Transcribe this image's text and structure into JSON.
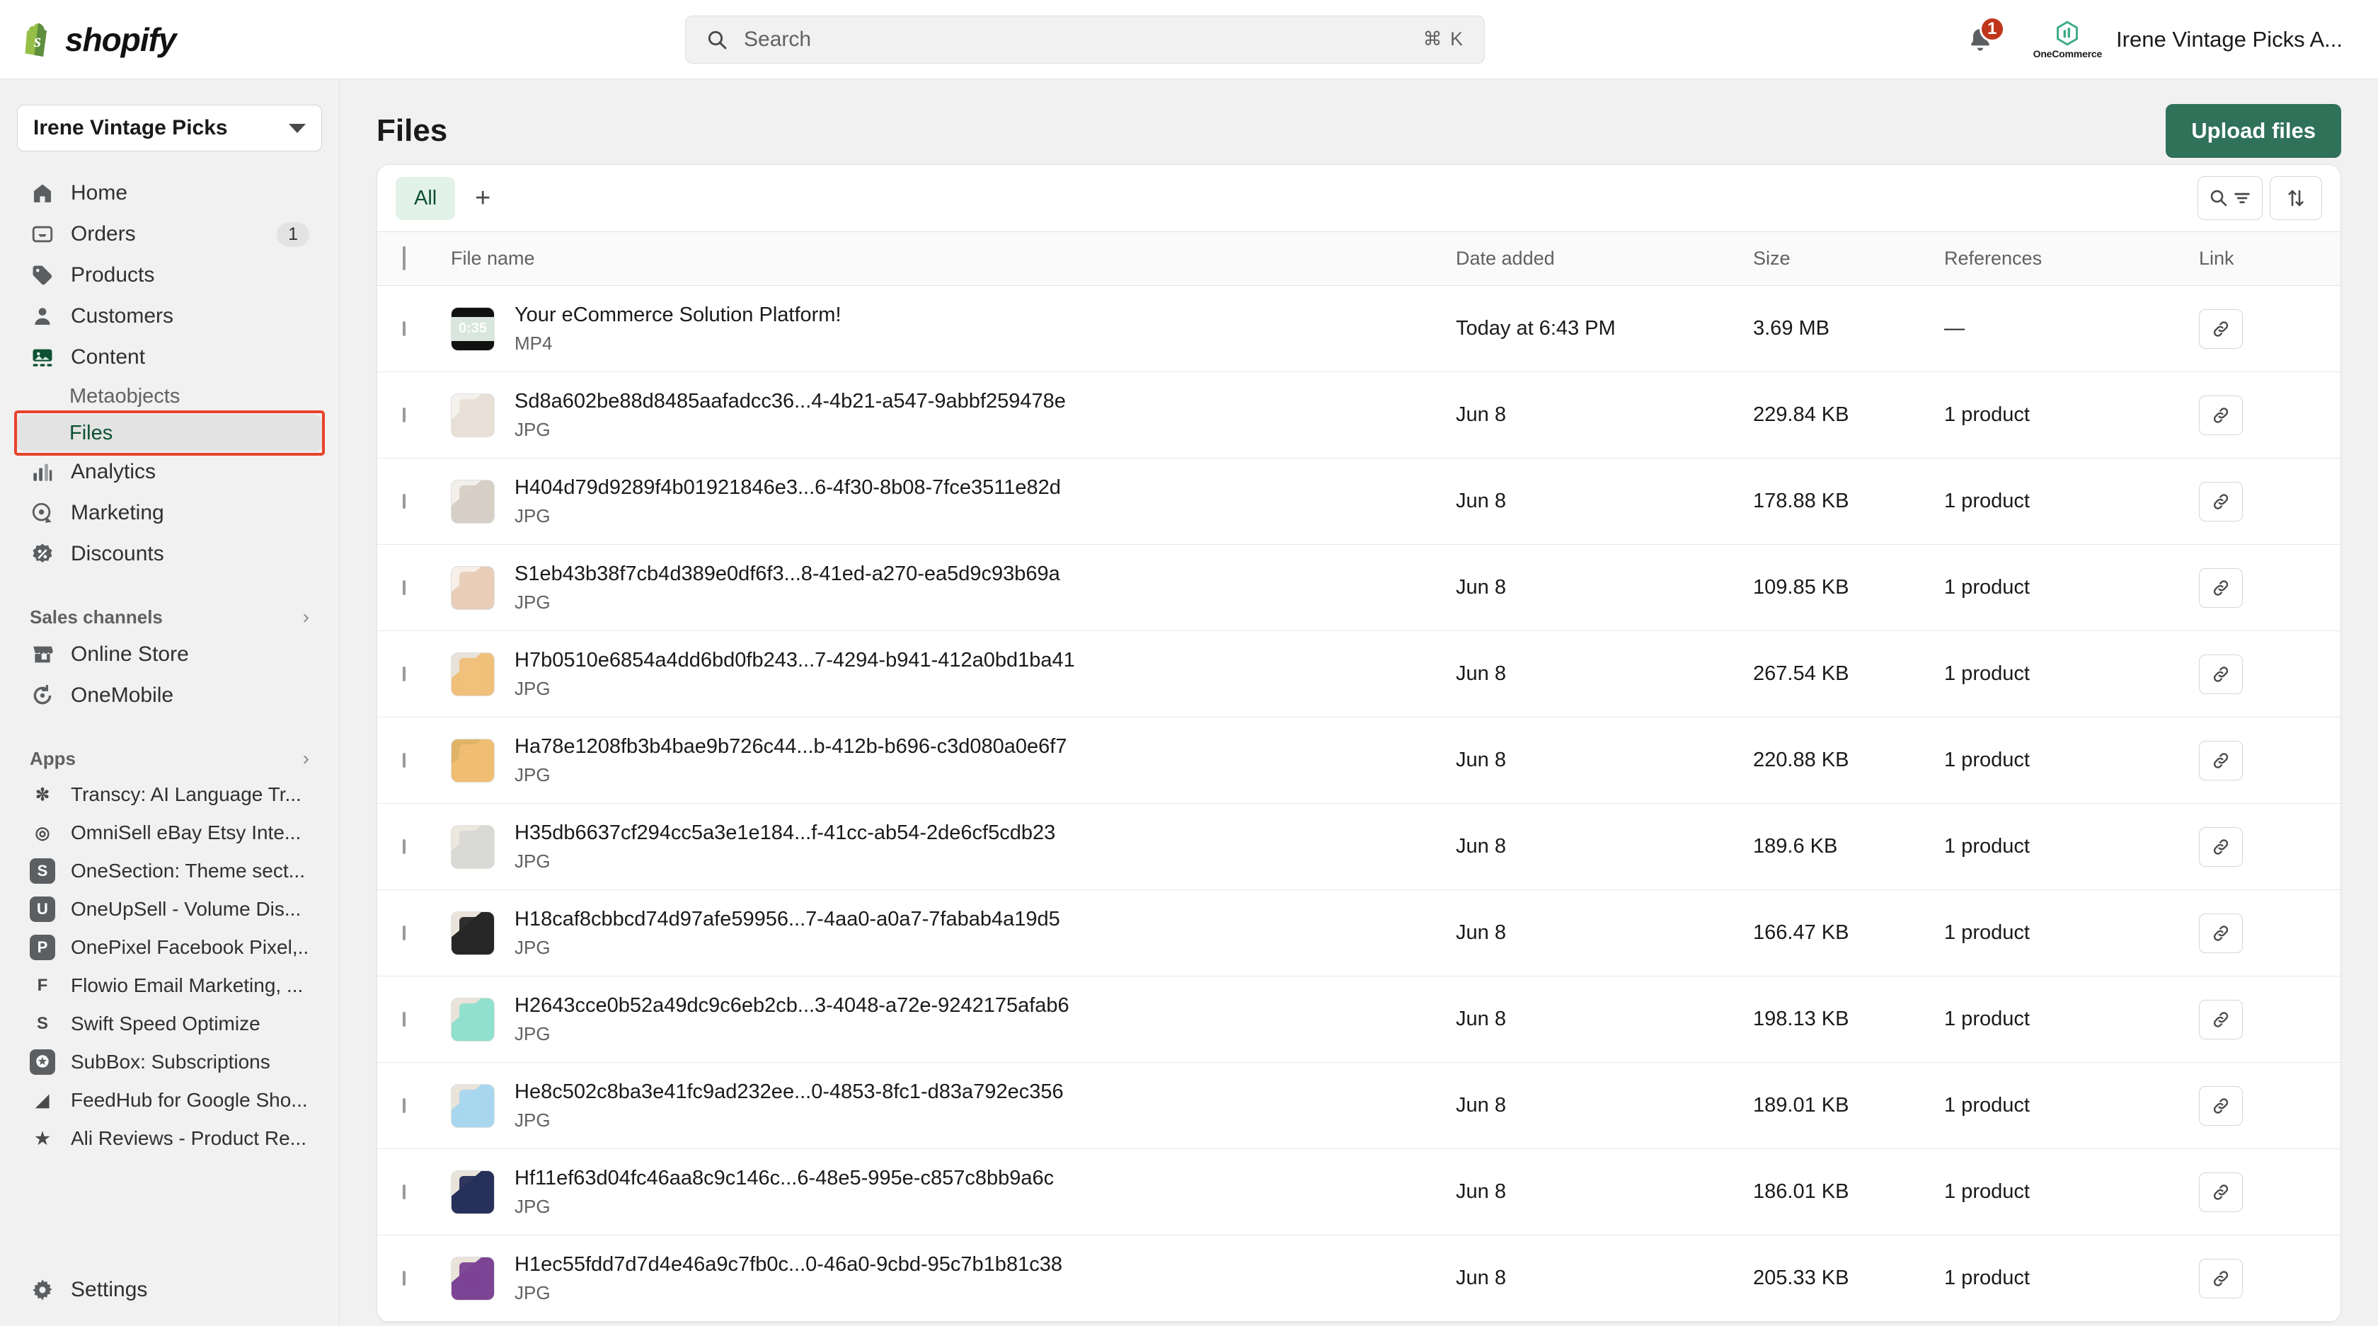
{
  "topbar": {
    "brand": "shopify",
    "search": {
      "placeholder": "Search",
      "shortcut": "⌘ K"
    },
    "notifications_count": "1",
    "account_app_name": "OneCommerce",
    "account_name": "Irene Vintage Picks A..."
  },
  "sidebar": {
    "store_name": "Irene Vintage Picks",
    "nav": [
      {
        "label": "Home",
        "icon": "home-icon",
        "badge": ""
      },
      {
        "label": "Orders",
        "icon": "orders-icon",
        "badge": "1"
      },
      {
        "label": "Products",
        "icon": "products-tag-icon",
        "badge": ""
      },
      {
        "label": "Customers",
        "icon": "customers-person-icon",
        "badge": ""
      },
      {
        "label": "Content",
        "icon": "content-image-icon",
        "badge": ""
      }
    ],
    "content_children": [
      {
        "label": "Metaobjects",
        "active": false
      },
      {
        "label": "Files",
        "active": true
      }
    ],
    "nav2": [
      {
        "label": "Analytics",
        "icon": "analytics-bars-icon"
      },
      {
        "label": "Marketing",
        "icon": "marketing-target-icon"
      },
      {
        "label": "Discounts",
        "icon": "discounts-percent-icon"
      }
    ],
    "sales_channels_title": "Sales channels",
    "sales_channels": [
      {
        "label": "Online Store",
        "icon": "online-store-icon"
      },
      {
        "label": "OneMobile",
        "icon": "onemobile-icon"
      }
    ],
    "apps_title": "Apps",
    "apps": [
      {
        "label": "Transcy: AI Language Tr...",
        "glyph": "✼",
        "boxed": false
      },
      {
        "label": "OmniSell eBay Etsy Inte...",
        "glyph": "◎",
        "boxed": false
      },
      {
        "label": "OneSection: Theme sect...",
        "glyph": "S",
        "boxed": true
      },
      {
        "label": "OneUpSell - Volume Dis...",
        "glyph": "U",
        "boxed": true
      },
      {
        "label": "OnePixel Facebook Pixel,...",
        "glyph": "P",
        "boxed": true
      },
      {
        "label": "Flowio Email Marketing, ...",
        "glyph": "F",
        "boxed": false
      },
      {
        "label": "Swift Speed Optimize",
        "glyph": "S",
        "boxed": false
      },
      {
        "label": "SubBox: Subscriptions",
        "glyph": "✪",
        "boxed": true
      },
      {
        "label": "FeedHub for Google Sho...",
        "glyph": "◢",
        "boxed": false
      },
      {
        "label": "Ali Reviews - Product Re...",
        "glyph": "★",
        "boxed": false
      }
    ],
    "settings_label": "Settings"
  },
  "main": {
    "page_title": "Files",
    "upload_button": "Upload files",
    "tabs": [
      {
        "label": "All",
        "active": true
      }
    ],
    "add_view_label": "+",
    "columns": [
      "File name",
      "Date added",
      "Size",
      "References",
      "Link"
    ],
    "rows": [
      {
        "name": "Your eCommerce Solution Platform!",
        "type": "MP4",
        "date": "Today at 6:43 PM",
        "size": "3.69 MB",
        "refs": "—",
        "thumb": "video",
        "duration": "0:35",
        "color1": "#d8e6dd",
        "color2": "#bcd3c3"
      },
      {
        "name": "Sd8a602be88d8485aafadcc36...4-4b21-a547-9abbf259478e",
        "type": "JPG",
        "date": "Jun 8",
        "size": "229.84 KB",
        "refs": "1 product",
        "thumb": "image",
        "duration": "",
        "color1": "#e8e0d6",
        "color2": "#f5f2ee"
      },
      {
        "name": "H404d79d9289f4b01921846e3...6-4f30-8b08-7fce3511e82d",
        "type": "JPG",
        "date": "Jun 8",
        "size": "178.88 KB",
        "refs": "1 product",
        "thumb": "image",
        "duration": "",
        "color1": "#d6cfc6",
        "color2": "#f3f0ec"
      },
      {
        "name": "S1eb43b38f7cb4d389e0df6f3...8-41ed-a270-ea5d9c93b69a",
        "type": "JPG",
        "date": "Jun 8",
        "size": "109.85 KB",
        "refs": "1 product",
        "thumb": "image",
        "duration": "",
        "color1": "#e9cdb8",
        "color2": "#f7efe8"
      },
      {
        "name": "H7b0510e6854a4dd6bd0fb243...7-4294-b941-412a0bd1ba41",
        "type": "JPG",
        "date": "Jun 8",
        "size": "267.54 KB",
        "refs": "1 product",
        "thumb": "image",
        "duration": "",
        "color1": "#f0c07a",
        "color2": "#e8e2d8"
      },
      {
        "name": "Ha78e1208fb3b4bae9b726c44...b-412b-b696-c3d080a0e6f7",
        "type": "JPG",
        "date": "Jun 8",
        "size": "220.88 KB",
        "refs": "1 product",
        "thumb": "image",
        "duration": "",
        "color1": "#efbe72",
        "color2": "#e0b468"
      },
      {
        "name": "H35db6637cf294cc5a3e1e184...f-41cc-ab54-2de6cf5cdb23",
        "type": "JPG",
        "date": "Jun 8",
        "size": "189.6 KB",
        "refs": "1 product",
        "thumb": "image",
        "duration": "",
        "color1": "#d9d9d5",
        "color2": "#ece7df"
      },
      {
        "name": "H18caf8cbbcd74d97afe59956...7-4aa0-a0a7-7fabab4a19d5",
        "type": "JPG",
        "date": "Jun 8",
        "size": "166.47 KB",
        "refs": "1 product",
        "thumb": "image",
        "duration": "",
        "color1": "#262626",
        "color2": "#e9e3da"
      },
      {
        "name": "H2643cce0b52a49dc9c6eb2cb...3-4048-a72e-9242175afab6",
        "type": "JPG",
        "date": "Jun 8",
        "size": "198.13 KB",
        "refs": "1 product",
        "thumb": "image",
        "duration": "",
        "color1": "#8fe0cd",
        "color2": "#e9e3da"
      },
      {
        "name": "He8c502c8ba3e41fc9ad232ee...0-4853-8fc1-d83a792ec356",
        "type": "JPG",
        "date": "Jun 8",
        "size": "189.01 KB",
        "refs": "1 product",
        "thumb": "image",
        "duration": "",
        "color1": "#a8d6ef",
        "color2": "#e9e3da"
      },
      {
        "name": "Hf11ef63d04fc46aa8c9c146c...6-48e5-995e-c857c8bb9a6c",
        "type": "JPG",
        "date": "Jun 8",
        "size": "186.01 KB",
        "refs": "1 product",
        "thumb": "image",
        "duration": "",
        "color1": "#27305a",
        "color2": "#e9e3da"
      },
      {
        "name": "H1ec55fdd7d7d4e46a9c7fb0c...0-46a0-9cbd-95c7b1b81c38",
        "type": "JPG",
        "date": "Jun 8",
        "size": "205.33 KB",
        "refs": "1 product",
        "thumb": "image",
        "duration": "",
        "color1": "#7c4494",
        "color2": "#e9e3da"
      }
    ]
  },
  "colors": {
    "brand_green": "#95bf47",
    "primary_button": "#30715a",
    "accent_active": "#0c5132",
    "badge_red": "#c0351a",
    "highlight_red": "#e8432b"
  }
}
